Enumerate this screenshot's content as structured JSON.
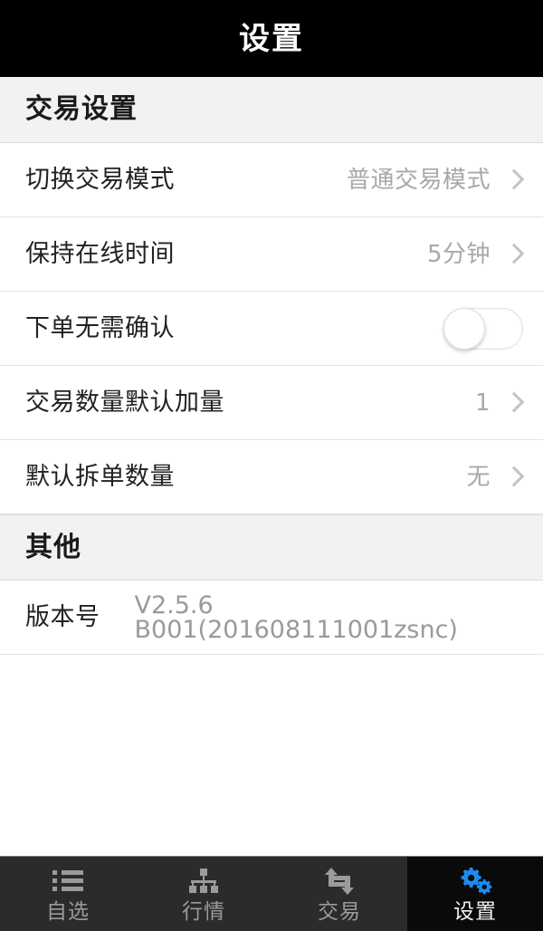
{
  "header": {
    "title": "设置"
  },
  "sections": [
    {
      "id": "trade-settings",
      "title": "交易设置",
      "rows": [
        {
          "id": "switch-trade-mode",
          "label": "切换交易模式",
          "value": "普通交易模式",
          "control": "chevron"
        },
        {
          "id": "keep-online-time",
          "label": "保持在线时间",
          "value": "5分钟",
          "control": "chevron"
        },
        {
          "id": "order-no-confirm",
          "label": "下单无需确认",
          "value": "",
          "control": "switch",
          "switch_state": "off"
        },
        {
          "id": "default-quantity-step",
          "label": "交易数量默认加量",
          "value": "1",
          "control": "chevron"
        },
        {
          "id": "default-split-order",
          "label": "默认拆单数量",
          "value": "无",
          "control": "chevron"
        }
      ]
    },
    {
      "id": "other",
      "title": "其他",
      "rows": [
        {
          "id": "version",
          "label": "版本号",
          "value": "V2.5.6 B001(201608111001zsnc)",
          "control": "none"
        }
      ]
    }
  ],
  "tabbar": {
    "items": [
      {
        "id": "watchlist",
        "label": "自选",
        "icon": "list-icon",
        "active": false
      },
      {
        "id": "quotes",
        "label": "行情",
        "icon": "hierarchy-icon",
        "active": false
      },
      {
        "id": "trade",
        "label": "交易",
        "icon": "exchange-arrows-icon",
        "active": false
      },
      {
        "id": "settings",
        "label": "设置",
        "icon": "gears-icon",
        "active": true
      }
    ]
  },
  "colors": {
    "header_background": "#000000",
    "header_text": "#ffffff",
    "section_background": "#f2f2f2",
    "row_background": "#ffffff",
    "row_label_text": "#222222",
    "row_value_text": "#a8a8a8",
    "divider": "#e3e3e3",
    "tabbar_background": "#2b2b2b",
    "tabbar_active_background": "#0a0a0a",
    "tab_inactive_text": "#9b9b9b",
    "tab_active_text": "#f2f2f2",
    "accent_blue": "#1a8cf0"
  }
}
